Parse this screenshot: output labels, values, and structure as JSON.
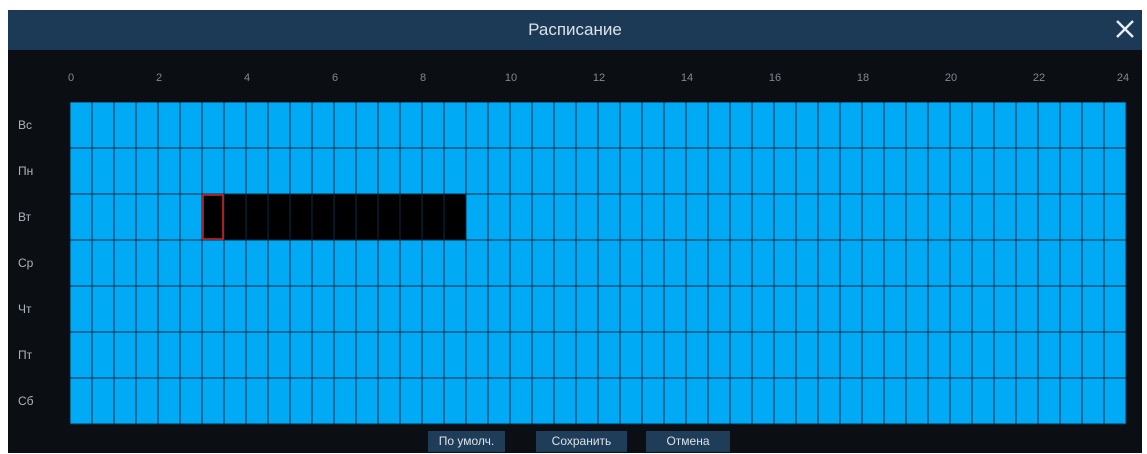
{
  "dialog": {
    "title": "Расписание",
    "close_icon": "close-icon"
  },
  "hour_labels": [
    "0",
    "2",
    "4",
    "6",
    "8",
    "10",
    "12",
    "14",
    "16",
    "18",
    "20",
    "22",
    "24"
  ],
  "days": [
    "Вс",
    "Пн",
    "Вт",
    "Ср",
    "Чт",
    "Пт",
    "Сб"
  ],
  "schedule": {
    "slots_per_day": 48,
    "slot_minutes": 30,
    "unselected_ranges": [
      {
        "day": "Вт",
        "from": "3:00",
        "to": "9:00"
      }
    ]
  },
  "buttons": {
    "default": "По умолч.",
    "save": "Сохранить",
    "cancel": "Отмена"
  },
  "colors": {
    "title_bar": "#1c3a55",
    "background": "#0b0e12",
    "selected_cell": "#00aaf5",
    "unselected_cell": "#000000",
    "cursor_highlight": "#d02020",
    "button": "#1f3d59"
  }
}
